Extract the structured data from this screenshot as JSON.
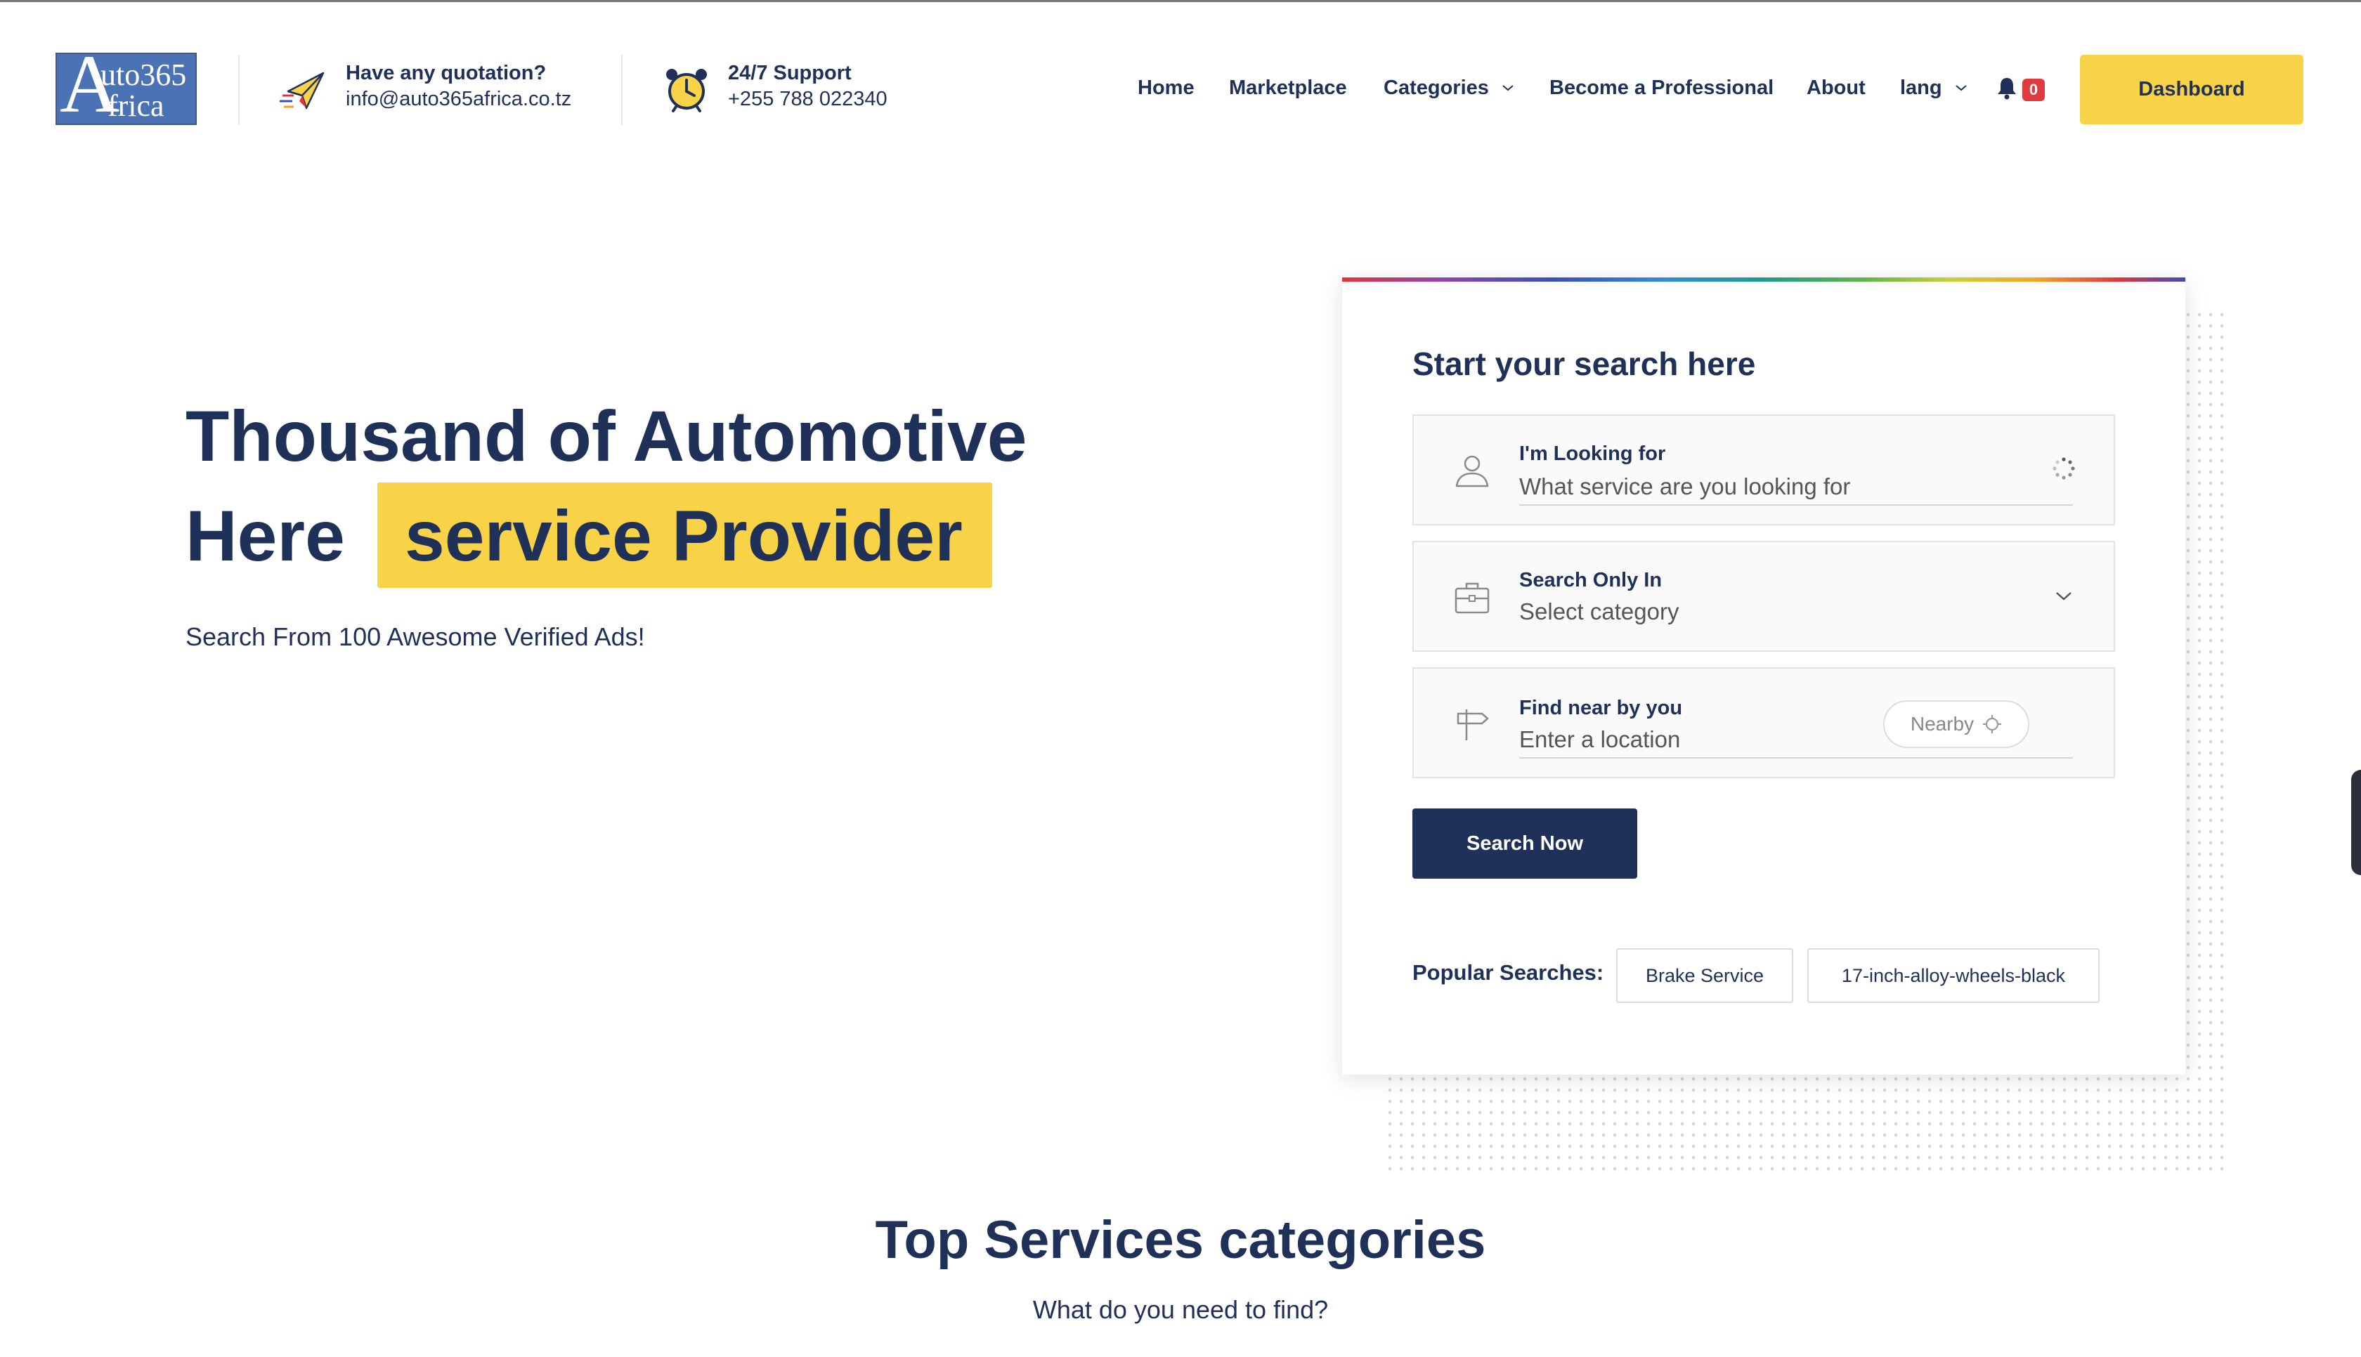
{
  "brand": {
    "logo_line1": "uto365",
    "logo_line2": "frica",
    "logo_letter": "A"
  },
  "header": {
    "quotation": {
      "title": "Have any quotation?",
      "value": "info@auto365africa.co.tz"
    },
    "support": {
      "title": "24/7 Support",
      "value": "+255 788 022340"
    },
    "nav": {
      "home": "Home",
      "marketplace": "Marketplace",
      "categories": "Categories",
      "become_professional": "Become a Professional",
      "about": "About",
      "lang": "lang"
    },
    "notification_count": "0",
    "dashboard_label": "Dashboard"
  },
  "hero": {
    "line1": "Thousand of Automotive",
    "line2_prefix": "Here",
    "line2_highlight": "service Provider",
    "subtitle": "Search From 100 Awesome Verified Ads!"
  },
  "search": {
    "title": "Start your search here",
    "looking_for": {
      "label": "I'm Looking for",
      "placeholder": "What service are you looking for"
    },
    "search_only_in": {
      "label": "Search Only In",
      "selected": "Select category"
    },
    "near_by": {
      "label": "Find near by you",
      "placeholder": "Enter a location",
      "nearby_label": "Nearby"
    },
    "submit_label": "Search Now",
    "popular_label": "Popular Searches:",
    "popular": [
      "Brake Service",
      "17-inch-alloy-wheels-black"
    ]
  },
  "section": {
    "title": "Top Services categories",
    "subtitle": "What do you need to find?"
  },
  "colors": {
    "navy": "#1f3158",
    "accent_yellow": "#f8d247",
    "badge_red": "#e0393e",
    "logo_blue": "#4c72b6"
  }
}
